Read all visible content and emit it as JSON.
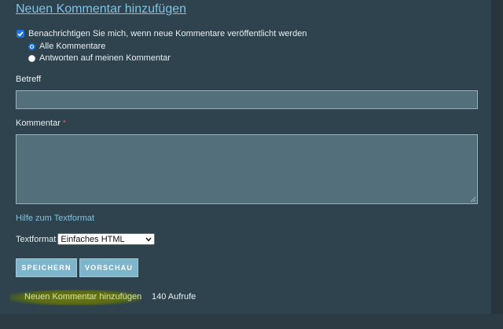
{
  "form": {
    "title": "Neuen Kommentar hinzufügen",
    "notify_label": "Benachrichtigen Sie mich, wenn neue Kommentare veröffentlicht werden",
    "notify_checked": true,
    "radio_options": [
      {
        "label": "Alle Kommentare",
        "checked": true
      },
      {
        "label": "Antworten auf meinen Kommentar",
        "checked": false
      }
    ],
    "subject_label": "Betreff",
    "subject_value": "",
    "comment_label": "Kommentar",
    "required_mark": "*",
    "comment_value": "",
    "help_link": "Hilfe zum Textformat",
    "format_label": "Textformat",
    "format_selected": "Einfaches HTML",
    "save_button": "SPEICHERN",
    "preview_button": "VORSCHAU"
  },
  "footer": {
    "add_comment_link": "Neuen Kommentar hinzufügen",
    "views": "140 Aufrufe"
  },
  "colors": {
    "background": "#2e434e",
    "link": "#7ec2e4",
    "button": "#7db5cb",
    "field": "#526f7b",
    "highlight": "#6f7a12"
  }
}
